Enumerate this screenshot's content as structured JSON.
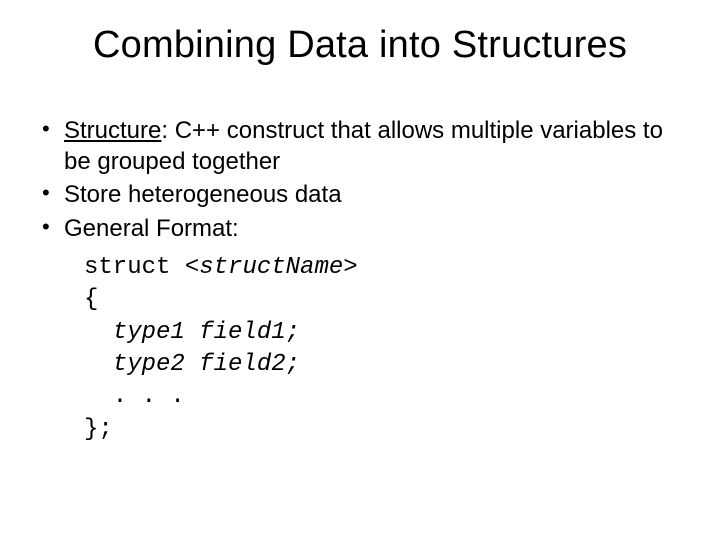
{
  "title": "Combining Data into Structures",
  "bullets": {
    "b1_term": "Structure",
    "b1_rest": ": C++ construct that allows multiple variables to be grouped together",
    "b2": "Store heterogeneous data",
    "b3": "General Format:"
  },
  "code": {
    "l1_kw": "struct ",
    "l1_it": "<structName>",
    "l2": "{",
    "l3_pre": "  ",
    "l3_it": "type1 field1;",
    "l4_pre": "  ",
    "l4_it": "type2 field2;",
    "l5": "  . . .",
    "l6": "};"
  }
}
